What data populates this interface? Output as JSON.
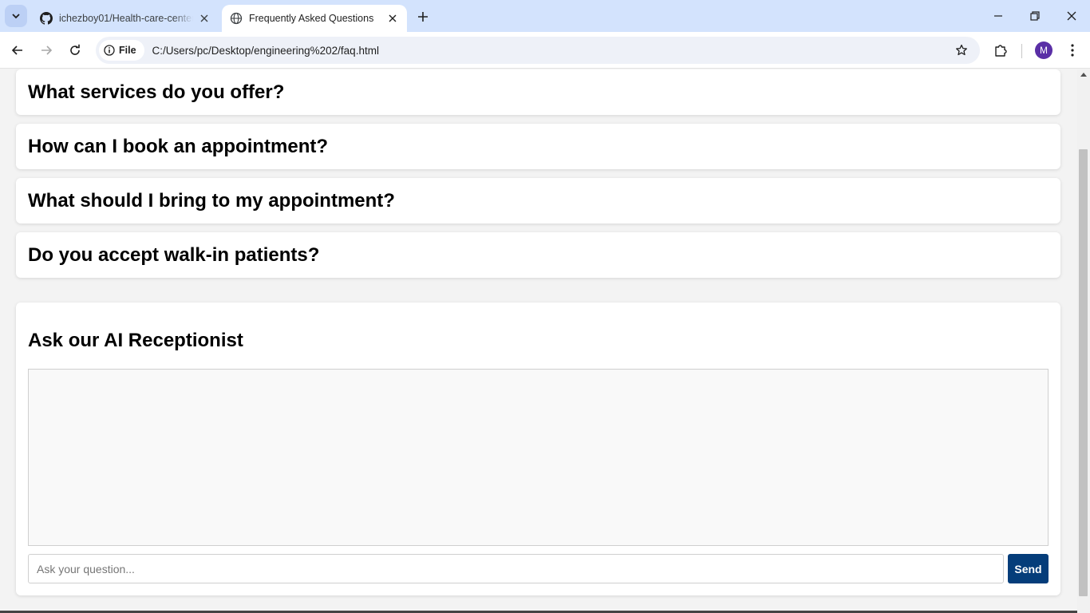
{
  "browser": {
    "tabs": [
      {
        "title": "ichezboy01/Health-care-center",
        "icon": "github-icon",
        "active": false
      },
      {
        "title": "Frequently Asked Questions",
        "icon": "globe-icon",
        "active": true
      }
    ],
    "site_chip": "File",
    "url": "C:/Users/pc/Desktop/engineering%202/faq.html",
    "profile_initial": "M"
  },
  "faq": {
    "questions": [
      "What services do you offer?",
      "How can I book an appointment?",
      "What should I bring to my appointment?",
      "Do you accept walk-in patients?"
    ]
  },
  "chat": {
    "heading": "Ask our AI Receptionist",
    "input_placeholder": "Ask your question...",
    "send_label": "Send"
  },
  "colors": {
    "tabstrip": "#d3e3fd",
    "send_button": "#053d7a",
    "avatar": "#5a2fa6"
  }
}
